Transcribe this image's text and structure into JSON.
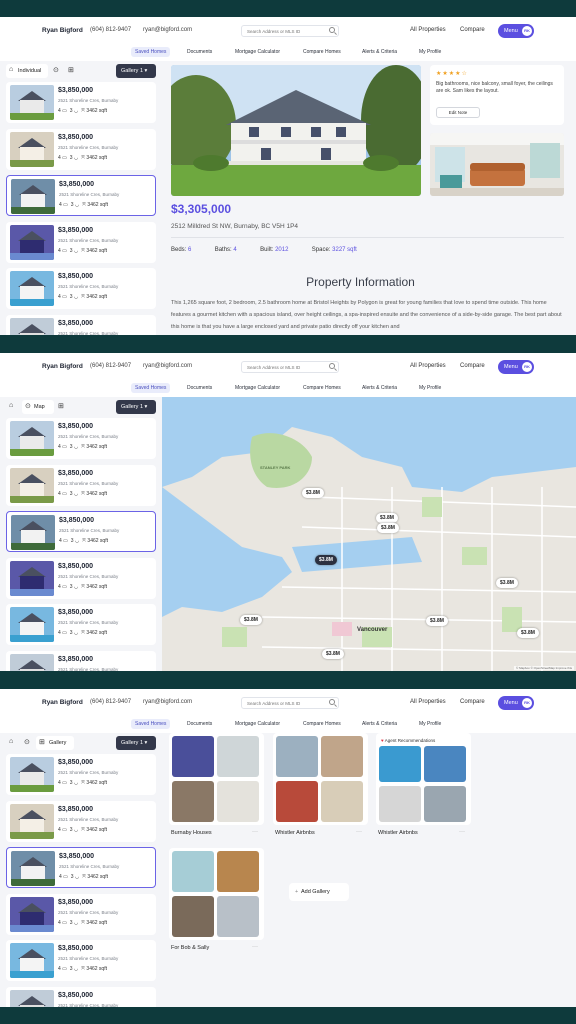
{
  "topbar": {
    "name": "Ryan Bigford",
    "phone": "(604) 812-9407",
    "email": "ryan@bigford.com",
    "search_placeholder": "Search Address or MLS ID",
    "all_properties": "All Properties",
    "compare": "Compare",
    "menu": "Menu",
    "avatar": "RK"
  },
  "subnav": [
    "Saved Homes",
    "Documents",
    "Mortgage Calculator",
    "Compare Homes",
    "Alerts & Criteria",
    "My Profile"
  ],
  "controls": {
    "individual": "Individual",
    "map": "Map",
    "gallery": "Gallery",
    "dropdown": "Gallery 1"
  },
  "listing": {
    "price": "$3,850,000",
    "address": "2521 Shoreline Cres, Burnaby",
    "beds": "4",
    "baths": "3",
    "sqft": "3462 sqft"
  },
  "detail": {
    "note_text": "Big bathrooms, nice balcony, small foyer, the ceilings are ok. Sam likes the layout.",
    "edit_note": "Edit Note",
    "price": "$3,305,000",
    "address": "2512 Milldred St NW, Burnaby, BC V5H 1P4",
    "beds_label": "Beds:",
    "beds": "6",
    "baths_label": "Baths:",
    "baths": "4",
    "built_label": "Built:",
    "built": "2012",
    "space_label": "Space:",
    "space": "3227 sqft",
    "section_title": "Property Information",
    "description": "This 1,265 square foot, 2 bedroom, 2.5 bathroom home at Bristol Heights by Polygon is great for young families that love to spend time outside. This home features a gourmet kitchen with a spacious island, over height ceilings, a spa-inspired ensuite and the convenience of a side-by-side garage. The best part about this home is that you have a large enclosed yard and private patio directly off your kitchen and"
  },
  "map": {
    "pins": [
      "$3.8M",
      "$3.8M",
      "$3.8M",
      "$3.8M",
      "$3.8M",
      "$3.8M",
      "$3.8M",
      "$3.8M",
      "$3.8M"
    ],
    "city_label": "Vancouver",
    "park_label": "STANLEY PARK",
    "attribution": "© Mapbox © OpenStreetMap Improve this"
  },
  "galleries": {
    "items": [
      "Burnaby Houses",
      "Whistler Airbnbs",
      "Whistler Airbnbs",
      "For Bob & Sally"
    ],
    "agent_tag": "Agent Recommendations",
    "add": "Add Gallery",
    "dots": "···"
  },
  "colors": {
    "accent": "#5b4fe0",
    "background": "#0e3a3c"
  }
}
